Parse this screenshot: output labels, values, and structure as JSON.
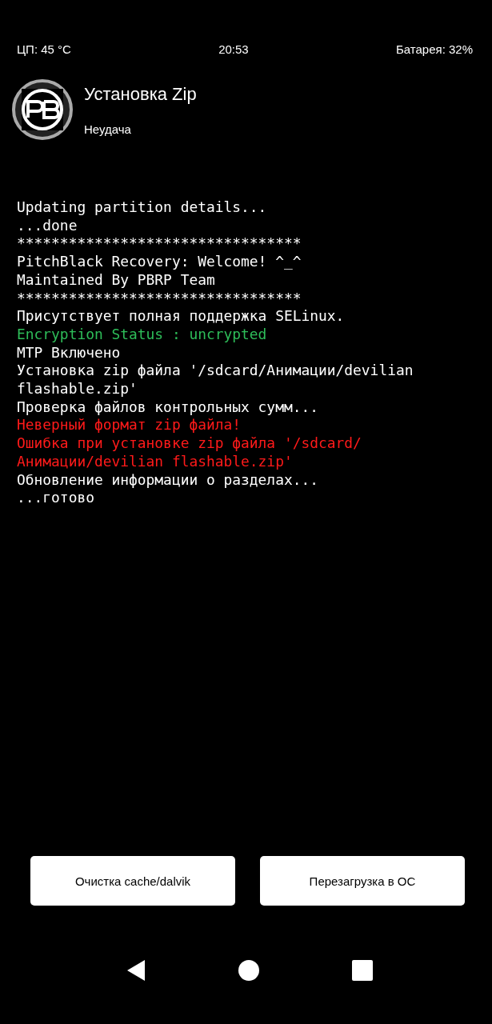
{
  "status_bar": {
    "cpu": "ЦП: 45 °C",
    "time": "20:53",
    "battery": "Батарея: 32%"
  },
  "header": {
    "title": "Установка Zip",
    "subtitle": "Неудача"
  },
  "log": [
    {
      "kind": "info",
      "text": "Updating partition details..."
    },
    {
      "kind": "info",
      "text": "...done"
    },
    {
      "kind": "info",
      "text": "*********************************"
    },
    {
      "kind": "info",
      "text": "PitchBlack Recovery: Welcome! ^_^"
    },
    {
      "kind": "info",
      "text": "Maintained By PBRP Team"
    },
    {
      "kind": "info",
      "text": "*********************************"
    },
    {
      "kind": "info",
      "text": "Присутствует полная поддержка SELinux."
    },
    {
      "kind": "success",
      "text": "Encryption Status : uncrypted"
    },
    {
      "kind": "info",
      "text": "MTP Включено"
    },
    {
      "kind": "info",
      "text": "Установка zip файла '/sdcard/Анимации/devilian flashable.zip'"
    },
    {
      "kind": "info",
      "text": "Проверка файлов контрольных сумм..."
    },
    {
      "kind": "error",
      "text": "Неверный формат zip файла!"
    },
    {
      "kind": "error",
      "text": "Ошибка при установке zip файла '/sdcard/Анимации/devilian flashable.zip'"
    },
    {
      "kind": "info",
      "text": "Обновление информации о разделах..."
    },
    {
      "kind": "info",
      "text": "...готово"
    }
  ],
  "buttons": [
    "Очистка cache/dalvik",
    "Перезагрузка в ОС"
  ]
}
